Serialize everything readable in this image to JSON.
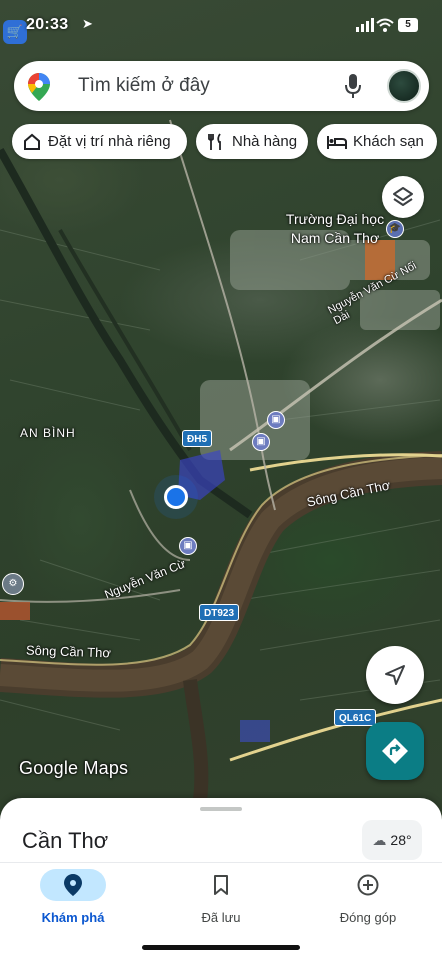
{
  "status_bar": {
    "time": "20:33",
    "battery": "5"
  },
  "search": {
    "placeholder": "Tìm kiếm ở đây"
  },
  "chips": [
    {
      "label": "Đặt vị trí nhà riêng",
      "icon": "home-icon"
    },
    {
      "label": "Nhà hàng",
      "icon": "restaurant-icon"
    },
    {
      "label": "Khách sạn",
      "icon": "hotel-icon"
    }
  ],
  "map": {
    "labels": {
      "university": "Trường Đại học Nam Cần Thơ",
      "area": "AN BÌNH",
      "river_1": "Sông Cần Thơ",
      "river_2": "Sông Cần Thơ",
      "road_1": "Nguyễn Văn Cừ",
      "road_2": "Nguyễn Văn Cừ Nối Dài"
    },
    "shields": {
      "dh5": "ĐH5",
      "dt923": "DT923",
      "ql61c": "QL61C"
    },
    "logo": "Google Maps"
  },
  "sheet": {
    "city": "Cần Thơ",
    "weather": "28°"
  },
  "bottom_nav": [
    {
      "label": "Khám phá",
      "icon": "explore-pin-icon",
      "active": true
    },
    {
      "label": "Đã lưu",
      "icon": "bookmark-icon",
      "active": false
    },
    {
      "label": "Đóng góp",
      "icon": "add-circle-icon",
      "active": false
    }
  ],
  "colors": {
    "accent": "#0b57d0",
    "directions": "#0b7d85",
    "location_dot": "#1a73e8"
  }
}
